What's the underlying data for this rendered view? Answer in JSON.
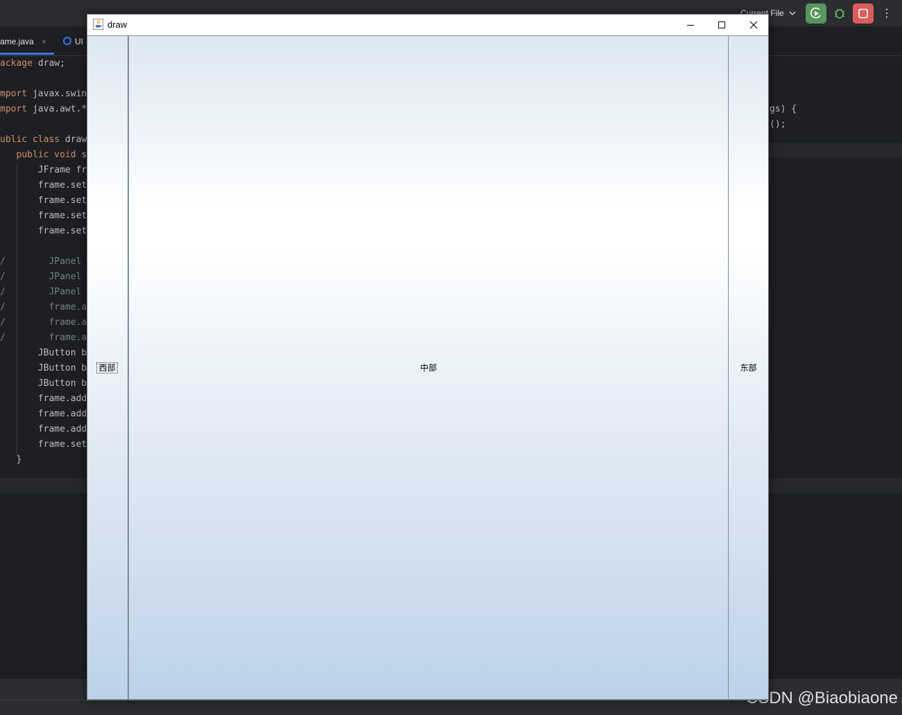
{
  "ide": {
    "tabs": [
      {
        "label": "ame.java",
        "close": "×"
      },
      {
        "label": "UI"
      }
    ],
    "run_config": "Current File",
    "more": "⋮",
    "code_left": [
      {
        "pre": "",
        "kw": "ackage",
        "rest": " draw;"
      },
      {
        "pre": "",
        "kw": "",
        "rest": ""
      },
      {
        "pre": "",
        "kw": "mport",
        "rest": " javax.swin"
      },
      {
        "pre": "",
        "kw": "mport",
        "rest": " java.awt.*"
      },
      {
        "pre": "",
        "kw": "",
        "rest": ""
      },
      {
        "pre": "",
        "kw": "ublic class",
        "rest": " draw"
      },
      {
        "pre": "   ",
        "kw": "public void",
        "rest": " s"
      },
      {
        "pre": "       ",
        "kw": "",
        "rest": "JFrame fr"
      },
      {
        "pre": "       ",
        "kw": "",
        "rest": "frame.set"
      },
      {
        "pre": "       ",
        "kw": "",
        "rest": "frame.set"
      },
      {
        "pre": "       ",
        "kw": "",
        "rest": "frame.set"
      },
      {
        "pre": "       ",
        "kw": "",
        "rest": "frame.set"
      },
      {
        "pre": "",
        "kw": "",
        "rest": ""
      },
      {
        "pre": "/        ",
        "kw": "",
        "rest": "JPanel",
        "comment": true
      },
      {
        "pre": "/        ",
        "kw": "",
        "rest": "JPanel",
        "comment": true
      },
      {
        "pre": "/        ",
        "kw": "",
        "rest": "JPanel",
        "comment": true
      },
      {
        "pre": "/        ",
        "kw": "",
        "rest": "frame.a",
        "comment": true
      },
      {
        "pre": "/        ",
        "kw": "",
        "rest": "frame.a",
        "comment": true
      },
      {
        "pre": "/        ",
        "kw": "",
        "rest": "frame.a",
        "comment": true
      },
      {
        "pre": "       ",
        "kw": "",
        "rest": "JButton b"
      },
      {
        "pre": "       ",
        "kw": "",
        "rest": "JButton b"
      },
      {
        "pre": "       ",
        "kw": "",
        "rest": "JButton b"
      },
      {
        "pre": "       ",
        "kw": "",
        "rest": "frame.add"
      },
      {
        "pre": "       ",
        "kw": "",
        "rest": "frame.add"
      },
      {
        "pre": "       ",
        "kw": "",
        "rest": "frame.add"
      },
      {
        "pre": "       ",
        "kw": "",
        "rest": "frame.set"
      },
      {
        "pre": "   ",
        "kw": "",
        "rest": "}"
      }
    ],
    "code_right": [
      "gs) {",
      "();"
    ],
    "watermark": "CSDN @Biaobiaone",
    "colors": {
      "run": "#57965c",
      "stop": "#db5c5c",
      "accent": "#3574f0"
    }
  },
  "window": {
    "title": "draw",
    "controls": {
      "minimize": "minimize-icon",
      "maximize": "maximize-icon",
      "close": "close-icon"
    },
    "buttons": {
      "west": "西部",
      "center": "中部",
      "east": "东部"
    }
  }
}
